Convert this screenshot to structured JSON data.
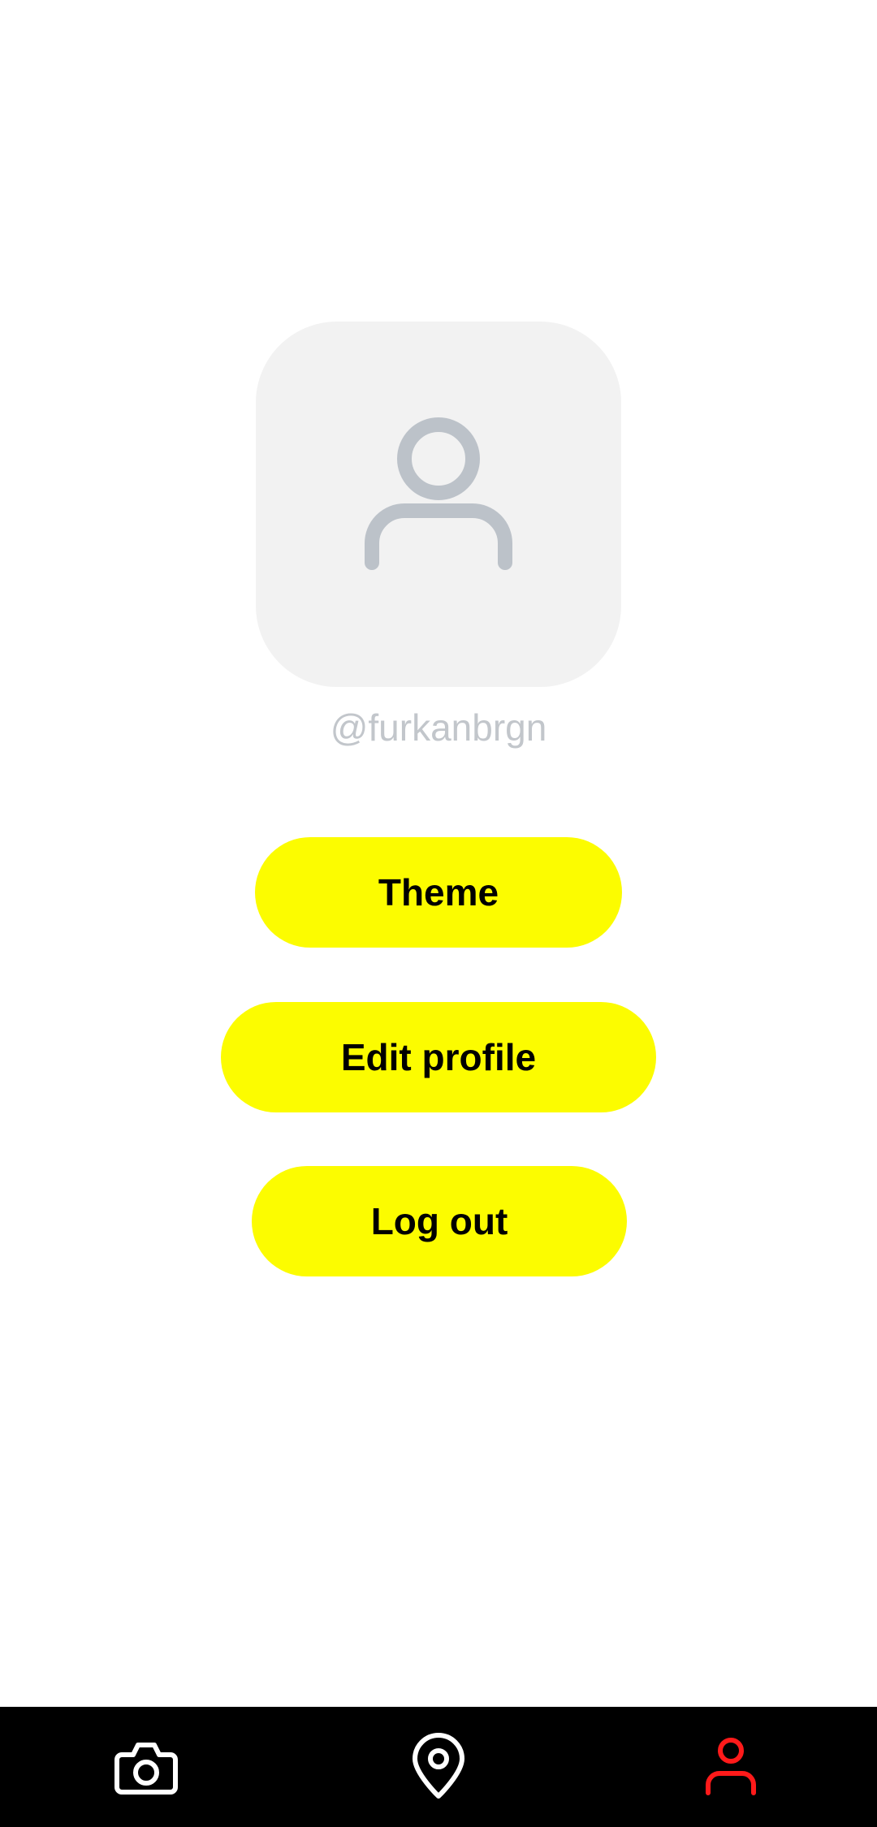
{
  "profile": {
    "username": "@furkanbrgn",
    "avatar_icon": "user-icon",
    "avatar_bg": "#f2f2f2",
    "avatar_icon_color": "#bcc2c9"
  },
  "actions": {
    "theme_label": "Theme",
    "edit_profile_label": "Edit profile",
    "logout_label": "Log out",
    "button_color": "#fcfc00"
  },
  "navbar": {
    "background": "#000000",
    "items": [
      {
        "name": "camera",
        "icon": "camera-icon",
        "color": "#ffffff",
        "active": false
      },
      {
        "name": "map",
        "icon": "map-pin-icon",
        "color": "#ffffff",
        "active": false
      },
      {
        "name": "profile",
        "icon": "user-icon",
        "color": "#ff1a1a",
        "active": true
      }
    ]
  }
}
